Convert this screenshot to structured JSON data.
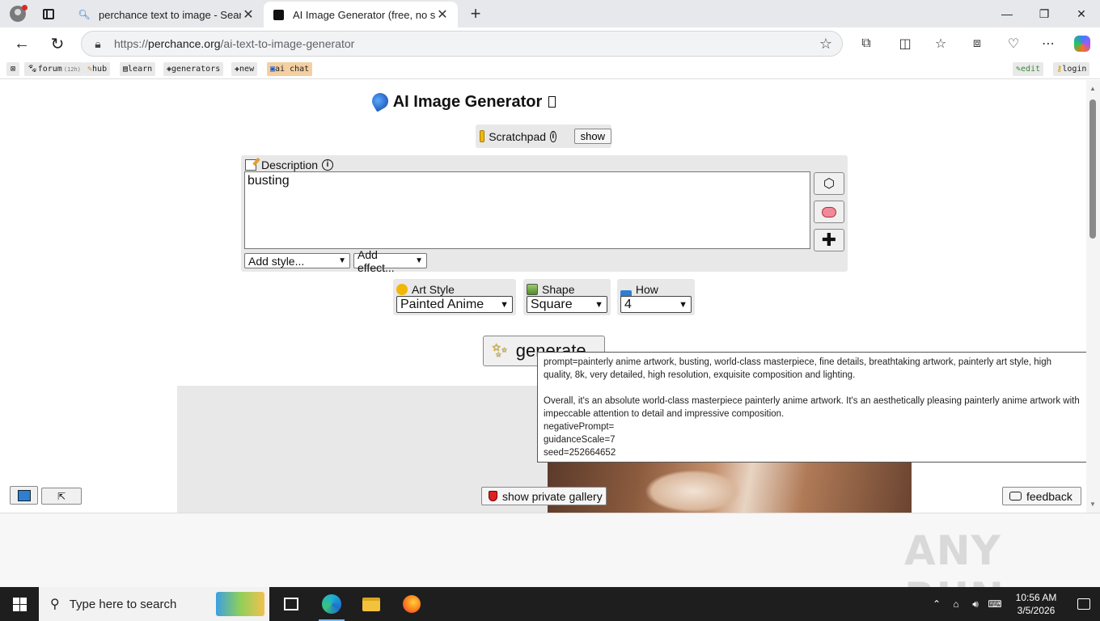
{
  "browser": {
    "tabs": [
      {
        "title": "perchance text to image - Search",
        "icon": "search-icon"
      },
      {
        "title": "AI Image Generator (free, no sign",
        "icon": "dice-icon"
      }
    ],
    "url_prefix": "https://",
    "url_host": "perchance.org",
    "url_path": "/ai-text-to-image-generator"
  },
  "bookmarks": [
    {
      "label": "forum",
      "badge": "(12h)",
      "icon": "paw-icon"
    },
    {
      "label": "hub",
      "icon": "pencil-icon"
    },
    {
      "label": "learn",
      "icon": "book-icon"
    },
    {
      "label": "generators",
      "icon": "tag-icon"
    },
    {
      "label": "new",
      "icon": "plus-icon"
    },
    {
      "label": "ai chat",
      "icon": "chat-icon"
    },
    {
      "label": "edit",
      "icon": "edit-icon"
    },
    {
      "label": "login",
      "icon": "key-icon"
    }
  ],
  "page": {
    "title": "AI Image Generator",
    "scratchpad_label": "Scratchpad",
    "scratchpad_show": "show",
    "description_label": "Description",
    "description_value": "busting",
    "add_style": "Add style...",
    "add_effect": "Add effect...",
    "art_style_label": "Art Style",
    "art_style_value": "Painted Anime",
    "shape_label": "Shape",
    "shape_value": "Square",
    "howmany_label": "How many?",
    "howmany_value": "4",
    "generate_label": "generate",
    "show_private_gallery": "show private gallery",
    "feedback": "feedback",
    "up_arrow": "⇱"
  },
  "tooltip": {
    "line1": "prompt=painterly anime artwork, busting, world-class masterpiece, fine details, breathtaking artwork, painterly art style, high quality, 8k, very detailed, high resolution, exquisite composition and lighting.",
    "line2": "Overall, it's an absolute world-class masterpiece painterly anime artwork. It's an aesthetically pleasing painterly anime artwork with impeccable attention to detail and impressive composition.",
    "line3": "negativePrompt=",
    "line4": "guidanceScale=7",
    "line5": "seed=252664652"
  },
  "watermark": "ANY RUN",
  "taskbar": {
    "search_placeholder": "Type here to search",
    "time": "10:56 AM",
    "date": "3/5/2026"
  }
}
